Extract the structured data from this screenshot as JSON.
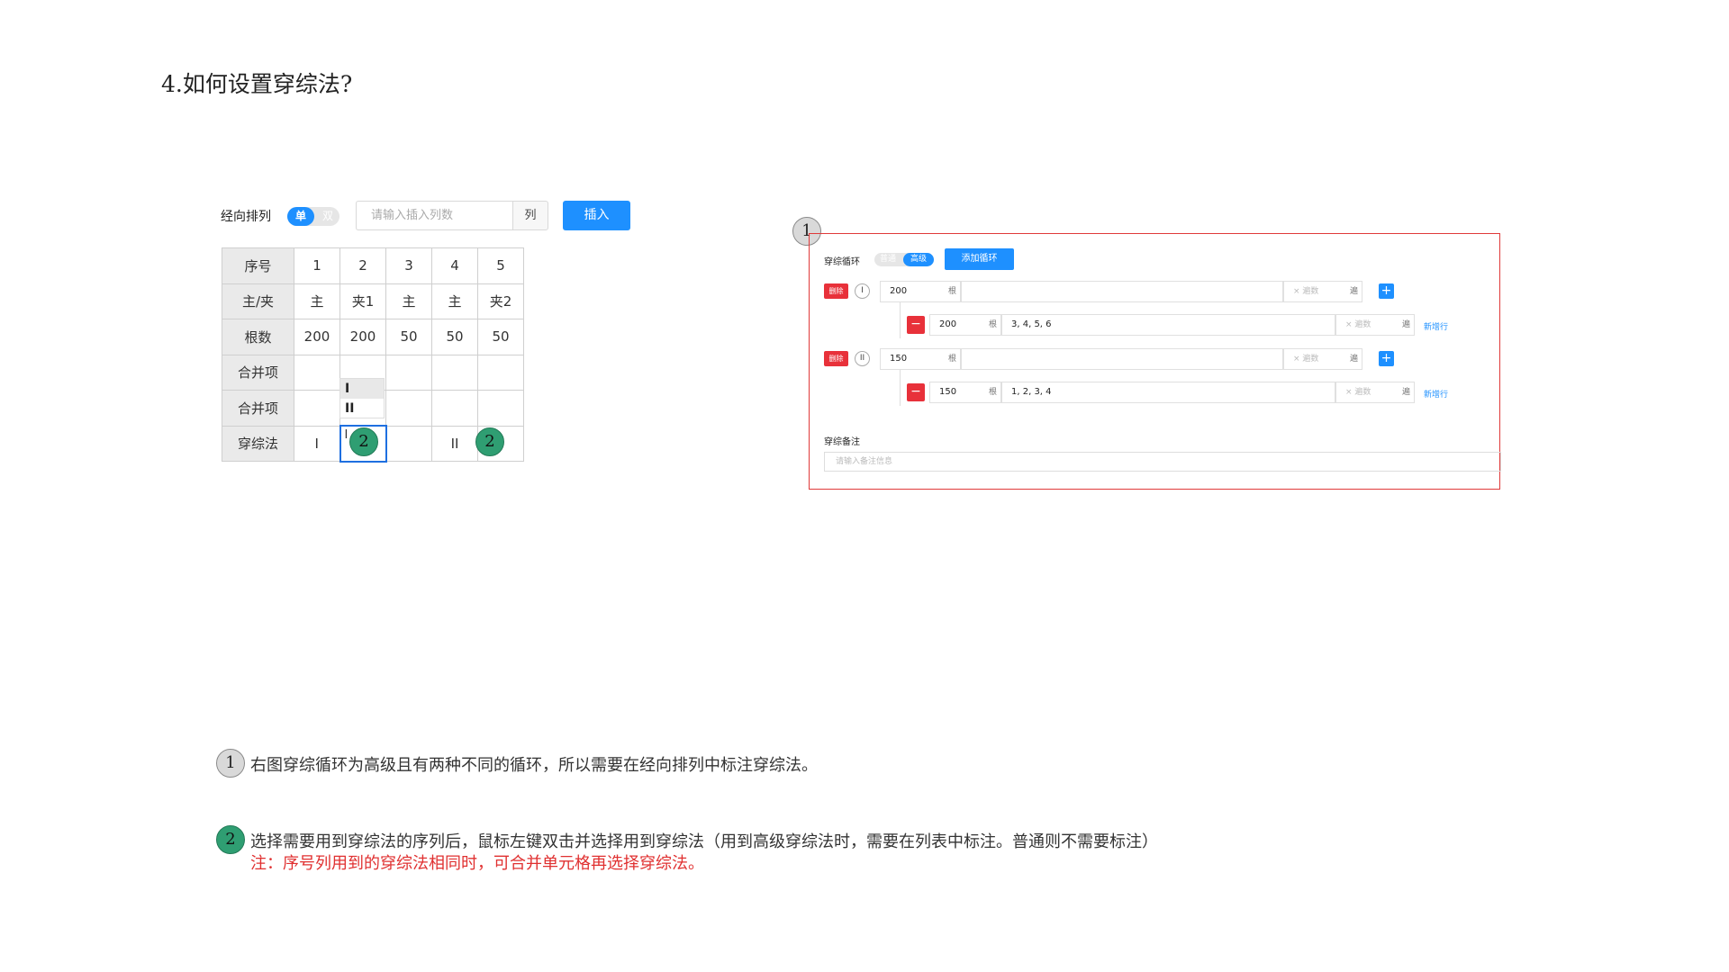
{
  "page_title": "4.如何设置穿综法?",
  "left": {
    "warp_label": "经向排列",
    "toggle": {
      "on": "单",
      "off": "双"
    },
    "insert_placeholder": "请输入插入列数",
    "insert_suffix": "列",
    "insert_button": "插入",
    "table": {
      "rows": [
        {
          "head": "序号",
          "cells": [
            "1",
            "2",
            "3",
            "4",
            "5"
          ]
        },
        {
          "head": "主/夹",
          "cells": [
            "主",
            "夹1",
            "主",
            "主",
            "夹2"
          ]
        },
        {
          "head": "根数",
          "cells": [
            "200",
            "200",
            "50",
            "50",
            "50"
          ]
        },
        {
          "head": "合并项",
          "cells": [
            "",
            "",
            "",
            "",
            ""
          ]
        },
        {
          "head": "合并项",
          "cells": [
            "",
            "",
            "",
            "",
            ""
          ]
        },
        {
          "head": "穿综法",
          "cells": [
            "I",
            "I",
            "",
            "II",
            ""
          ]
        }
      ]
    },
    "dropdown_options": [
      "I",
      "II"
    ],
    "marker_2": "2"
  },
  "right": {
    "marker_1": "1",
    "loop_label": "穿综循环",
    "toggle": {
      "off": "普通",
      "on": "高级"
    },
    "add_loop_button": "添加循环",
    "delete_label": "删除",
    "unit_gen": "根",
    "times_placeholder": "遍数",
    "unit_times": "遍",
    "new_row": "新增行",
    "loops": [
      {
        "roman": "I",
        "count": "200",
        "sub_count": "200",
        "sub_sequence": "3, 4, 5, 6"
      },
      {
        "roman": "II",
        "count": "150",
        "sub_count": "150",
        "sub_sequence": "1, 2, 3, 4"
      }
    ],
    "remark_label": "穿综备注",
    "remark_placeholder": "请输入备注信息"
  },
  "notes": {
    "n1_marker": "1",
    "n1_text": "右图穿综循环为高级且有两种不同的循环，所以需要在经向排列中标注穿综法。",
    "n2_marker": "2",
    "n2_text": "选择需要用到穿综法的序列后，鼠标左键双击并选择用到穿综法（用到高级穿综法时，需要在列表中标注。普通则不需要标注）",
    "n2_note": "注：序号列用到的穿综法相同时，可合并单元格再选择穿综法。"
  },
  "colors": {
    "accent": "#1e90ff",
    "danger": "#e8313a",
    "marker_green": "#2f9e72",
    "highlight_border": "#e03a3a"
  }
}
